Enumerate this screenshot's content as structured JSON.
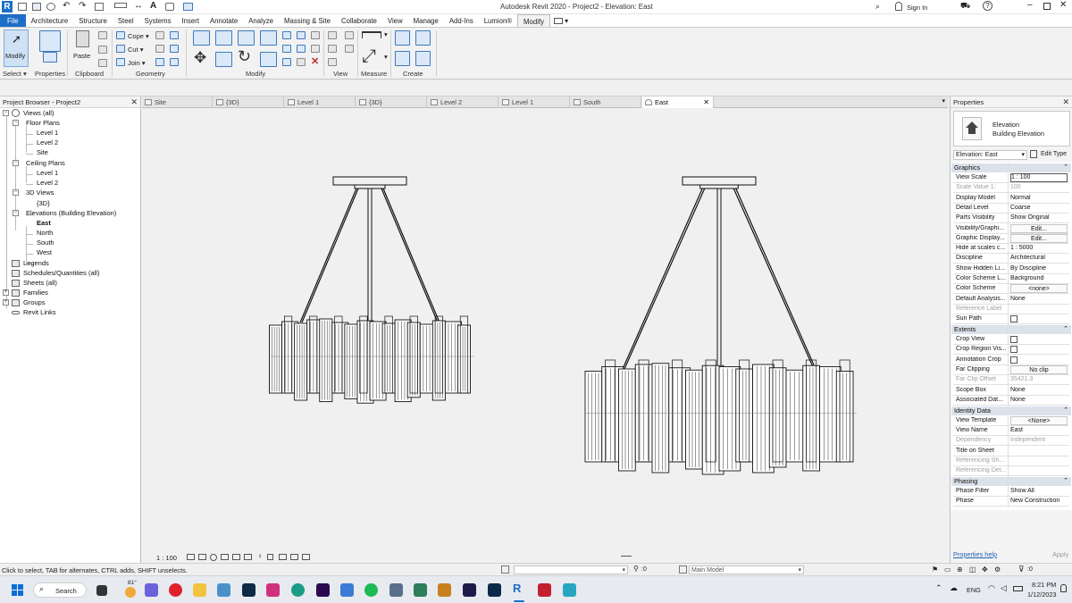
{
  "titlebar": {
    "title": "Autodesk Revit 2020 - Project2 - Elevation: East",
    "sign_in": "Sign In",
    "help_icon": "question-icon"
  },
  "menu": [
    {
      "label": "File"
    },
    {
      "label": "Architecture"
    },
    {
      "label": "Structure"
    },
    {
      "label": "Steel"
    },
    {
      "label": "Systems"
    },
    {
      "label": "Insert"
    },
    {
      "label": "Annotate"
    },
    {
      "label": "Analyze"
    },
    {
      "label": "Massing & Site"
    },
    {
      "label": "Collaborate"
    },
    {
      "label": "View"
    },
    {
      "label": "Manage"
    },
    {
      "label": "Add-Ins"
    },
    {
      "label": "Lumion®"
    },
    {
      "label": "Modify"
    }
  ],
  "ribbon": {
    "modify": "Modify",
    "paste": "Paste",
    "cope": "Cope",
    "cut": "Cut",
    "join": "Join",
    "panels": {
      "select": "Select",
      "properties": "Properties",
      "clipboard": "Clipboard",
      "geometry": "Geometry",
      "modify": "Modify",
      "view": "View",
      "measure": "Measure",
      "create": "Create"
    }
  },
  "project_browser": {
    "title": "Project Browser - Project2",
    "views_all": "Views (all)",
    "floor_plans": "Floor Plans",
    "fp_level1": "Level 1",
    "fp_level2": "Level 2",
    "fp_site": "Site",
    "ceiling_plans": "Ceiling Plans",
    "cp_level1": "Level 1",
    "cp_level2": "Level 2",
    "views_3d": "3D Views",
    "v3d": "{3D}",
    "elevations": "Elevations (Building Elevation)",
    "east": "East",
    "north": "North",
    "south": "South",
    "west": "West",
    "legends": "Legends",
    "schedules": "Schedules/Quantities (all)",
    "sheets": "Sheets (all)",
    "families": "Families",
    "groups": "Groups",
    "revit_links": "Revit Links"
  },
  "tabs": [
    {
      "label": "Site"
    },
    {
      "label": "{3D}"
    },
    {
      "label": "Level 1"
    },
    {
      "label": "{3D}"
    },
    {
      "label": "Level 2"
    },
    {
      "label": "Level 1"
    },
    {
      "label": "South"
    },
    {
      "label": "East"
    }
  ],
  "view_control": {
    "scale": "1 : 100"
  },
  "properties": {
    "title": "Properties",
    "type_name": "Elevation",
    "type_sub": "Building Elevation",
    "selector": "Elevation: East",
    "edit_type": "Edit Type",
    "groups": {
      "graphics": "Graphics",
      "extents": "Extents",
      "identity": "Identity Data",
      "phasing": "Phasing"
    },
    "graphics": [
      {
        "k": "View Scale",
        "v": "1 : 100"
      },
      {
        "k": "Scale Value    1:",
        "v": "100"
      },
      {
        "k": "Display Model",
        "v": "Normal"
      },
      {
        "k": "Detail Level",
        "v": "Coarse"
      },
      {
        "k": "Parts Visibility",
        "v": "Show Original"
      },
      {
        "k": "Visibility/Graphi...",
        "v": "Edit..."
      },
      {
        "k": "Graphic Display...",
        "v": "Edit..."
      },
      {
        "k": "Hide at scales c...",
        "v": "1 : 5000"
      },
      {
        "k": "Discipline",
        "v": "Architectural"
      },
      {
        "k": "Show Hidden Li...",
        "v": "By Discipline"
      },
      {
        "k": "Color Scheme L...",
        "v": "Background"
      },
      {
        "k": "Color Scheme",
        "v": "<none>"
      },
      {
        "k": "Default Analysis...",
        "v": "None"
      },
      {
        "k": "Reference Label",
        "v": ""
      },
      {
        "k": "Sun Path",
        "v": ""
      }
    ],
    "extents": [
      {
        "k": "Crop View",
        "v": ""
      },
      {
        "k": "Crop Region Vis...",
        "v": ""
      },
      {
        "k": "Annotation Crop",
        "v": ""
      },
      {
        "k": "Far Clipping",
        "v": "No clip"
      },
      {
        "k": "Far Clip Offset",
        "v": "35421.3"
      },
      {
        "k": "Scope Box",
        "v": "None"
      },
      {
        "k": "Associated Dat...",
        "v": "None"
      }
    ],
    "identity": [
      {
        "k": "View Template",
        "v": "<None>"
      },
      {
        "k": "View Name",
        "v": "East"
      },
      {
        "k": "Dependency",
        "v": "Independent"
      },
      {
        "k": "Title on Sheet",
        "v": ""
      },
      {
        "k": "Referencing Sh...",
        "v": ""
      },
      {
        "k": "Referencing Det...",
        "v": ""
      }
    ],
    "phasing": [
      {
        "k": "Phase Filter",
        "v": "Show All"
      },
      {
        "k": "Phase",
        "v": "New Construction"
      }
    ],
    "help_link": "Properties help",
    "apply": "Apply"
  },
  "status": {
    "message": "Click to select, TAB for alternates, CTRL adds, SHIFT unselects.",
    "workset": ":0",
    "model": "Main Model",
    "filter": ":0"
  },
  "taskbar": {
    "search": "Search",
    "temp": "81°",
    "lang": "ENG",
    "time": "8:21 PM",
    "date": "1/12/2023"
  }
}
